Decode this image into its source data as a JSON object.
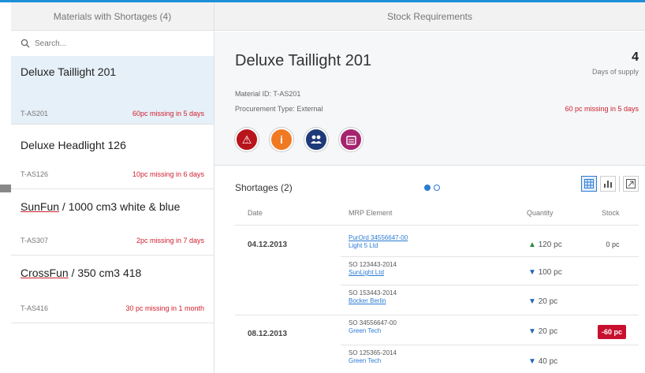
{
  "left_panel": {
    "header": "Materials with Shortages (4)",
    "search_placeholder": "Search...",
    "items": [
      {
        "title": "Deluxe Taillight 201",
        "id": "T-AS201",
        "missing": "60pc missing in 5 days"
      },
      {
        "title": "Deluxe Headlight 126",
        "id": "T-AS126",
        "missing": "10pc missing in 6 days"
      },
      {
        "title_part1": "SunFun",
        "title_part2": " / 1000 cm3 white & blue",
        "id": "T-AS307",
        "missing": "2pc missing in 7 days"
      },
      {
        "title_part1": "CrossFun",
        "title_part2": " / 350 cm3 418",
        "id": "T-AS416",
        "missing": "30 pc missing in 1 month"
      }
    ]
  },
  "right_panel": {
    "header": "Stock Requirements",
    "title": "Deluxe Taillight 201",
    "kpi_number": "4",
    "kpi_label": "Days of supply",
    "material_id": "Material ID: T-AS201",
    "procurement": "Procurement Type: External",
    "missing": "60 pc missing in 5 days",
    "icons": [
      "alert-icon",
      "info-icon",
      "people-icon",
      "calendar-icon"
    ],
    "icon_glyphs": {
      "alert": "⚠",
      "info": "i"
    }
  },
  "table": {
    "title": "Shortages (2)",
    "columns": {
      "date": "Date",
      "mrp": "MRP Element",
      "qty": "Quantity",
      "stock": "Stock"
    },
    "groups": [
      {
        "date": "04.12.2013",
        "rows": [
          {
            "l1": "PurOrd 34556647-00",
            "l2": "Light 5 Ltd",
            "dir": "▲",
            "qty": "120 pc",
            "stock": "0 pc"
          },
          {
            "l1": "SO 123443-2014",
            "l2": "SunLight Ltd",
            "dir": "▼",
            "qty": "100 pc",
            "stock": ""
          },
          {
            "l1": "SO 153443-2014",
            "l2": "Bocker Berlin",
            "dir": "▼",
            "qty": "20 pc",
            "stock": ""
          }
        ]
      },
      {
        "date": "08.12.2013",
        "rows": [
          {
            "l1": "SO 34556647-00",
            "l2": "Green Tech",
            "dir": "▼",
            "qty": "20 pc",
            "stock": "-60 pc"
          },
          {
            "l1": "SO 125365-2014",
            "l2": "Green Tech",
            "dir": "▼",
            "qty": "40 pc",
            "stock": ""
          }
        ]
      }
    ]
  },
  "colors": {
    "accent": "#2a7bd4",
    "critical": "#d0202f",
    "positive": "#2b8a3e"
  }
}
